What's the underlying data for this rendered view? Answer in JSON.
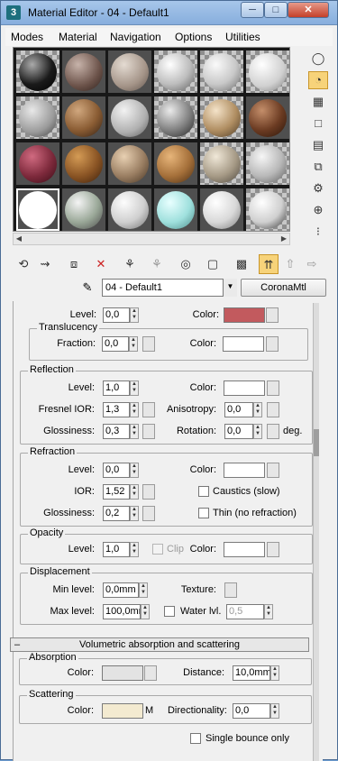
{
  "window": {
    "title": "Material Editor - 04 - Default1",
    "app_icon": "3ds-max-icon",
    "min": "─",
    "max": "□",
    "close": "✕"
  },
  "menu": {
    "modes": "Modes",
    "material": "Material",
    "navigation": "Navigation",
    "options": "Options",
    "utilities": "Utilities"
  },
  "colors": {
    "accent_active": "#f7d37a",
    "translucency_swatch": "#c25a5e",
    "scattering_swatch": "#f3ead0"
  },
  "material": {
    "name": "04 - Default1",
    "type": "CoronaMtl"
  },
  "vertical_toolbar": [
    "sample-type-icon",
    "backlight-icon",
    "background-icon",
    "sample-uv-icon",
    "video-color-check-icon",
    "make-preview-icon",
    "options-icon",
    "select-by-material-icon",
    "material-map-navigator-icon"
  ],
  "horizontal_toolbar": [
    "get-material-icon",
    "put-to-scene-icon",
    "assign-to-selection-icon",
    "reset-map-icon",
    "make-unique-icon",
    "put-to-library-icon",
    "material-id-icon",
    "show-map-icon",
    "show-end-result-icon",
    "go-to-parent-icon",
    "go-forward-sibling-icon"
  ],
  "params": {
    "top": {
      "level_label": "Level:",
      "level": "0,0",
      "color_label": "Color:"
    },
    "translucency": {
      "title": "Translucency",
      "fraction_label": "Fraction:",
      "fraction": "0,0",
      "color_label": "Color:"
    },
    "reflection": {
      "title": "Reflection",
      "level_label": "Level:",
      "level": "1,0",
      "color_label": "Color:",
      "fresnel_label": "Fresnel IOR:",
      "fresnel": "1,3",
      "aniso_label": "Anisotropy:",
      "aniso": "0,0",
      "gloss_label": "Glossiness:",
      "gloss": "0,3",
      "rotation_label": "Rotation:",
      "rotation": "0,0",
      "deg": "deg."
    },
    "refraction": {
      "title": "Refraction",
      "level_label": "Level:",
      "level": "0,0",
      "color_label": "Color:",
      "ior_label": "IOR:",
      "ior": "1,52",
      "caustics": "Caustics (slow)",
      "gloss_label": "Glossiness:",
      "gloss": "0,2",
      "thin": "Thin (no refraction)"
    },
    "opacity": {
      "title": "Opacity",
      "level_label": "Level:",
      "level": "1,0",
      "clip": "Clip",
      "color_label": "Color:"
    },
    "displacement": {
      "title": "Displacement",
      "min_label": "Min level:",
      "min": "0,0mm",
      "texture_label": "Texture:",
      "max_label": "Max level:",
      "max": "100,0mm",
      "water_label": "Water lvl.",
      "water": "0,5"
    },
    "volumetric": {
      "title": "Volumetric absorption and scattering",
      "collapse": "–"
    },
    "absorption": {
      "title": "Absorption",
      "color_label": "Color:",
      "distance_label": "Distance:",
      "distance": "10,0mm"
    },
    "scattering": {
      "title": "Scattering",
      "color_label": "Color:",
      "m": "M",
      "dir_label": "Directionality:",
      "dir": "0,0",
      "single_bounce": "Single bounce only"
    }
  }
}
